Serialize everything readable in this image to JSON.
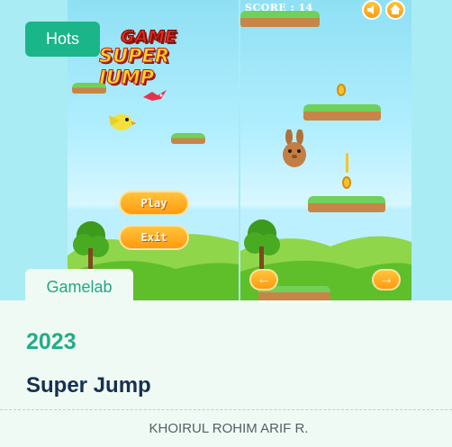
{
  "badge": {
    "label": "Hots"
  },
  "category": {
    "label": "Gamelab"
  },
  "game": {
    "year": "2023",
    "title": "Super Jump",
    "author": "KHOIRUL ROHIM ARIF R."
  },
  "screenshot_left": {
    "logo_line1": "GAME",
    "logo_line2": "SUPER JUMP",
    "play_label": "Play",
    "exit_label": "Exit"
  },
  "screenshot_right": {
    "score_text": "SCORE : 14",
    "sound_icon": "speaker-icon",
    "home_icon": "home-icon",
    "left_arrow": "←",
    "right_arrow": "→"
  },
  "colors": {
    "accent": "#1bb58a",
    "title": "#16304f",
    "card_bg": "#f0faf4",
    "thumb_bg": "#a9ecf3"
  }
}
